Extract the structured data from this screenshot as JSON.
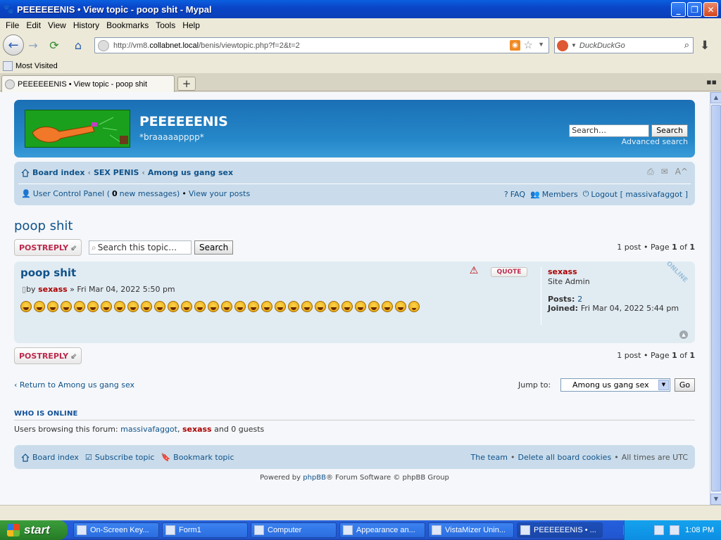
{
  "window": {
    "title": "PEEEEEENIS • View topic - poop shit - Mypal",
    "buttons": {
      "minimize": "_",
      "maximize": "❐",
      "close": "✕"
    }
  },
  "menu": [
    "File",
    "Edit",
    "View",
    "History",
    "Bookmarks",
    "Tools",
    "Help"
  ],
  "toolbar": {
    "url_prefix": "http://vm8.",
    "url_domain": "collabnet.local",
    "url_rest": "/benis/viewtopic.php?f=2&t=2",
    "search_placeholder": "DuckDuckGo"
  },
  "bookmarks": {
    "most_visited": "Most Visited"
  },
  "tabs": [
    {
      "label": "PEEEEEENIS • View topic - poop shit"
    }
  ],
  "forum": {
    "site_title": "PEEEEEENIS",
    "site_desc": "*braaaaapppp*",
    "search_placeholder": "Search…",
    "search_button": "Search",
    "advanced_search": "Advanced search",
    "breadcrumb": [
      "Board index",
      "SEX PENIS",
      "Among us gang sex"
    ],
    "ucp": {
      "ucp_label": "User Control Panel (",
      "new_count": "0",
      "new_label": " new messages)",
      "view_posts": "View your posts",
      "faq": "FAQ",
      "members": "Members",
      "logout": "Logout [ massivafaggot ]"
    },
    "topic_title": "poop shit",
    "postreply_label": "POSTREPLY",
    "topic_search_placeholder": "Search this topic…",
    "topic_search_button": "Search",
    "pagination": "1 post • Page ",
    "page_current": "1",
    "page_of": " of ",
    "page_total": "1",
    "post": {
      "title": "poop shit",
      "by": "by ",
      "author": "sexass",
      "date": " » Fri Mar 04, 2022 5:50 pm",
      "quote_label": "QUOTE",
      "smiley_count_laugh": 29,
      "online_label": "ONLINE",
      "profile": {
        "username": "sexass",
        "rank": "Site Admin",
        "posts_label": "Posts: ",
        "posts": "2",
        "joined_label": "Joined: ",
        "joined": "Fri Mar 04, 2022 5:44 pm"
      }
    },
    "return_link": "Return to Among us gang sex",
    "jump_label": "Jump to:",
    "jump_selected": "Among us gang sex",
    "go_button": "Go",
    "who_online_title": "WHO IS ONLINE",
    "who_online_prefix": "Users browsing this forum: ",
    "who_online_user1": "massivafaggot",
    "who_online_sep": ", ",
    "who_online_user2": "sexass",
    "who_online_suffix": " and 0 guests",
    "footer": {
      "board_index": "Board index",
      "subscribe": "Subscribe topic",
      "bookmark": "Bookmark topic",
      "team": "The team",
      "delete_cookies": "Delete all board cookies",
      "timezone": "All times are UTC"
    },
    "powered_prefix": "Powered by ",
    "powered_link": "phpBB",
    "powered_suffix": "® Forum Software © phpBB Group"
  },
  "taskbar": {
    "start": "start",
    "tasks": [
      "On-Screen Key...",
      "Form1",
      "Computer",
      "Appearance an...",
      "VistaMizer Unin...",
      "PEEEEEENIS • ..."
    ],
    "clock": "1:08 PM"
  },
  "colors": {
    "accent": "#105289",
    "header_blue": "#2588c9",
    "user_red": "#aa0000",
    "reply_red": "#bc2a4d"
  }
}
